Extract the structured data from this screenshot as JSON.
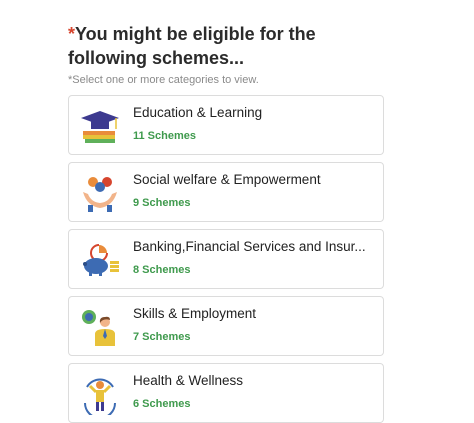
{
  "header": {
    "asterisk": "*",
    "title": "You might be eligible for the following schemes...",
    "subtitle": "*Select one or more categories to view."
  },
  "categories": [
    {
      "name": "Education & Learning",
      "count": "11 Schemes",
      "icon": "education-icon"
    },
    {
      "name": "Social welfare & Empowerment",
      "count": "9 Schemes",
      "icon": "social-welfare-icon"
    },
    {
      "name": "Banking,Financial Services and Insur...",
      "count": "8 Schemes",
      "icon": "banking-icon"
    },
    {
      "name": "Skills & Employment",
      "count": "7 Schemes",
      "icon": "skills-icon"
    },
    {
      "name": "Health & Wellness",
      "count": "6 Schemes",
      "icon": "health-icon"
    }
  ]
}
